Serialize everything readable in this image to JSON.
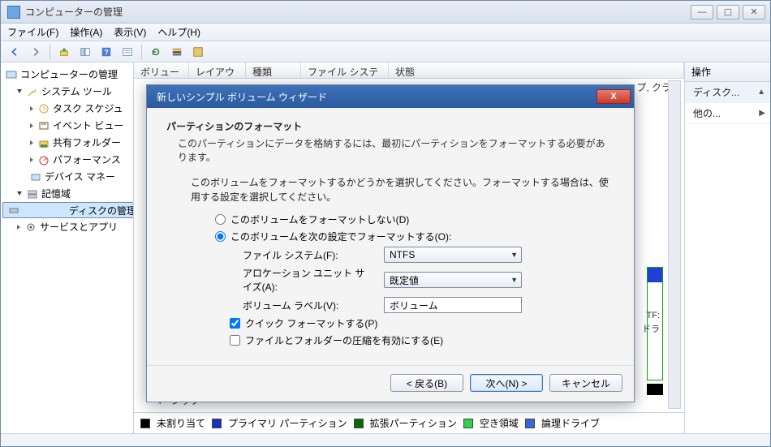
{
  "window": {
    "title": "コンピューターの管理"
  },
  "menus": {
    "file": "ファイル(F)",
    "action": "操作(A)",
    "view": "表示(V)",
    "help": "ヘルプ(H)"
  },
  "tree": {
    "root": "コンピューターの管理",
    "sys_tools": "システム ツール",
    "task": "タスク スケジュ",
    "event": "イベント ビュー",
    "shared": "共有フォルダー",
    "perf": "パフォーマンス",
    "devmgr": "デバイス マネー",
    "storage": "記憶域",
    "diskmgmt": "ディスクの管理",
    "services": "サービスとアプリ"
  },
  "columns": {
    "c1": "ボリューム",
    "c2": "レイアウト",
    "c3": "種類",
    "c4": "ファイル システム",
    "c5": "状態"
  },
  "behind": {
    "status_tail": "プ, クラッ",
    "basic": "ベーシック",
    "right_ntfs": "TF:",
    "right_drive": "ドラ"
  },
  "legend": {
    "a": "未割り当て",
    "b": "プライマリ パーティション",
    "c": "拡張パーティション",
    "d": "空き領域",
    "e": "論理ドライブ"
  },
  "actions": {
    "header": "操作",
    "disk": "ディスク...",
    "other": "他の..."
  },
  "dialog": {
    "title": "新しいシンプル ボリューム ウィザード",
    "h1": "パーティションのフォーマット",
    "sub": "このパーティションにデータを格納するには、最初にパーティションをフォーマットする必要があります。",
    "inst": "このボリュームをフォーマットするかどうかを選択してください。フォーマットする場合は、使用する設定を選択してください。",
    "radio_no": "このボリュームをフォーマットしない(D)",
    "radio_yes": "このボリュームを次の設定でフォーマットする(O):",
    "fs_label": "ファイル システム(F):",
    "fs_value": "NTFS",
    "alloc_label": "アロケーション ユニット サイズ(A):",
    "alloc_value": "既定値",
    "vol_label": "ボリューム ラベル(V):",
    "vol_value": "ボリューム",
    "quick": "クイック フォーマットする(P)",
    "compress": "ファイルとフォルダーの圧縮を有効にする(E)",
    "back": "< 戻る(B)",
    "next": "次へ(N) >",
    "cancel": "キャンセル"
  }
}
